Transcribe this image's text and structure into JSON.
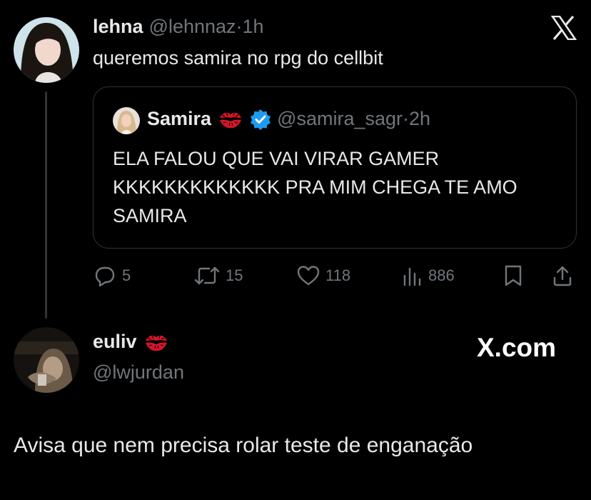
{
  "tweet": {
    "author_name": "lehna",
    "handle": "@lehnnaz",
    "separator": "·",
    "time": "1h",
    "text": "queremos samira no rpg do cellbit"
  },
  "quoted_tweet": {
    "author_name": "Samira",
    "handle": "@samira_sagr",
    "separator": "·",
    "time": "2h",
    "verified": true,
    "text": "ELA FALOU QUE VAI VIRAR GAMER KKKKKKKKKKKKK PRA MIM CHEGA TE AMO SAMIRA"
  },
  "actions": {
    "replies": "5",
    "retweets": "15",
    "likes": "118",
    "views": "886"
  },
  "reply": {
    "author_name": "euliv",
    "handle": "@lwjurdan",
    "text": "Avisa que nem precisa rolar teste de enganação"
  },
  "branding": {
    "watermark": "X.com"
  },
  "icons": {
    "close": "x-logo-icon",
    "kiss": "kiss-mark-icon",
    "verified": "verified-badge-icon",
    "reply": "reply-icon",
    "retweet": "retweet-icon",
    "like": "heart-icon",
    "views": "views-icon",
    "bookmark": "bookmark-icon",
    "share": "share-icon"
  },
  "colors": {
    "background": "#000000",
    "text": "#e7e9ea",
    "muted": "#71767b",
    "border": "#2f3336",
    "verified": "#1d9bf0",
    "kiss": "#d3152a"
  }
}
